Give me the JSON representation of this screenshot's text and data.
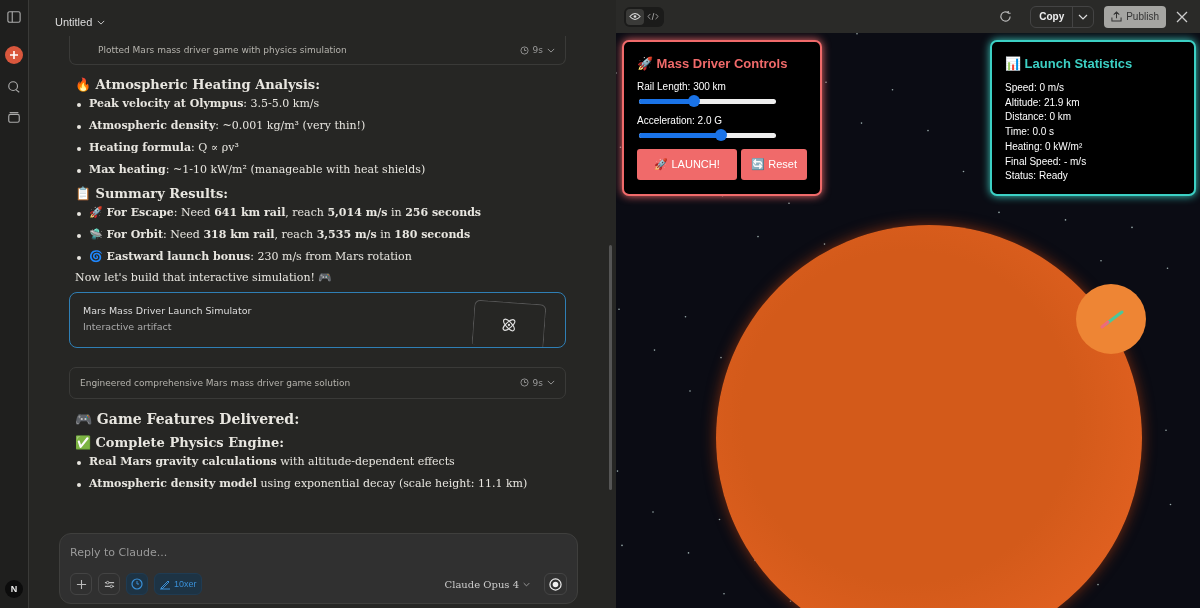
{
  "chat": {
    "title": "Untitled",
    "thinking_top": {
      "text": "Plotted Mars mass driver game with physics simulation",
      "time": "9s"
    },
    "sections": [
      {
        "heading": "🔥 Atmospheric Heating Analysis:",
        "items": [
          "**Peak velocity at Olympus**: 3.5-5.0 km/s",
          "**Atmospheric density**: ~0.001 kg/m³ (very thin!)",
          "**Heating formula**: Q ∝ ρv³",
          "**Max heating**: ~1-10 kW/m² (manageable with heat shields)"
        ]
      },
      {
        "heading": "📋 Summary Results:",
        "items": [
          "🚀 **For Escape**: Need **641 km rail**, reach **5,014 m/s** in **256 seconds**",
          "🛸 **For Orbit**: Need **318 km rail**, reach **3,535 m/s** in **180 seconds**",
          "🌀 **Eastward launch bonus**: 230 m/s from Mars rotation"
        ]
      }
    ],
    "outro": "Now let's build that interactive simulation! 🎮",
    "artifact": {
      "title": "Mars Mass Driver Launch Simulator",
      "subtitle": "Interactive artifact"
    },
    "thinking_bottom": {
      "text": "Engineered comprehensive Mars mass driver game solution",
      "time": "9s"
    },
    "features_heading": "🎮 Game Features Delivered:",
    "features_sub": "✅ Complete Physics Engine:",
    "features": [
      "**Real Mars gravity calculations** with altitude-dependent effects",
      "**Atmospheric density model** using exponential decay (scale height: 11.1 km)"
    ],
    "composer": {
      "placeholder": "Reply to Claude...",
      "style_chip": "10xer",
      "model": "Claude Opus 4"
    },
    "avatar": "N"
  },
  "preview": {
    "copy": "Copy",
    "publish": "Publish",
    "controls": {
      "title": "🚀 Mass Driver Controls",
      "sliders": [
        {
          "label": "Rail Length: 300 km",
          "level": 0.4
        },
        {
          "label": "Acceleration: 2.0 G",
          "level": 0.6
        }
      ],
      "buttons": [
        "🚀 LAUNCH!",
        "🔄 Reset"
      ]
    },
    "stats": {
      "title": "📊 Launch Statistics",
      "lines": [
        "Speed: 0 m/s",
        "Altitude: 21.9 km",
        "Distance: 0 km",
        "Time: 0.0 s",
        "Heating: 0 kW/m²",
        "Final Speed: - m/s",
        "Status: Ready"
      ]
    }
  }
}
